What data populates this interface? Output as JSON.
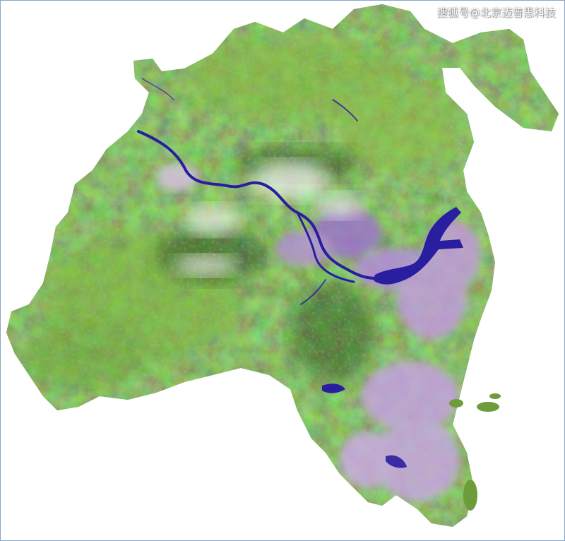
{
  "watermark": "搜狐号@北京迈普思科技",
  "map": {
    "kind": "satellite false-color composite",
    "colors": {
      "vegetation": "#5a8f2c",
      "vegetation_dark": "#2f5a1c",
      "vegetation_light": "#8fbf3f",
      "urban": "#b98ad8",
      "urban_light": "#e0b9ee",
      "water": "#2a1ea0",
      "haze": "#e9eef0",
      "background": "#ffffff"
    }
  }
}
